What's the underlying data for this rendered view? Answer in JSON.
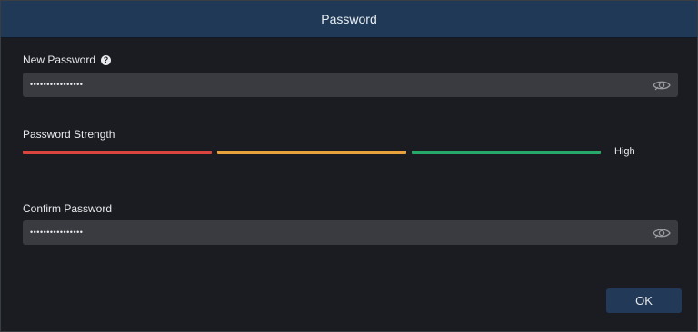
{
  "dialog": {
    "title": "Password"
  },
  "new_password": {
    "label": "New Password",
    "value": "••••••••••••••••",
    "help_icon": "question-circle-icon",
    "reveal_icon": "eye-icon"
  },
  "strength": {
    "label": "Password Strength",
    "level_text": "High",
    "segments": [
      {
        "name": "weak",
        "color": "#d9443f",
        "filled": true
      },
      {
        "name": "medium",
        "color": "#e8a23b",
        "filled": true
      },
      {
        "name": "strong",
        "color": "#27a86b",
        "filled": true
      }
    ]
  },
  "confirm_password": {
    "label": "Confirm Password",
    "value": "••••••••••••••••",
    "reveal_icon": "eye-icon"
  },
  "footer": {
    "ok_label": "OK"
  },
  "colors": {
    "titlebar": "#1f3957",
    "background": "#1a1c21",
    "field": "#393b40",
    "button": "#223a58"
  }
}
